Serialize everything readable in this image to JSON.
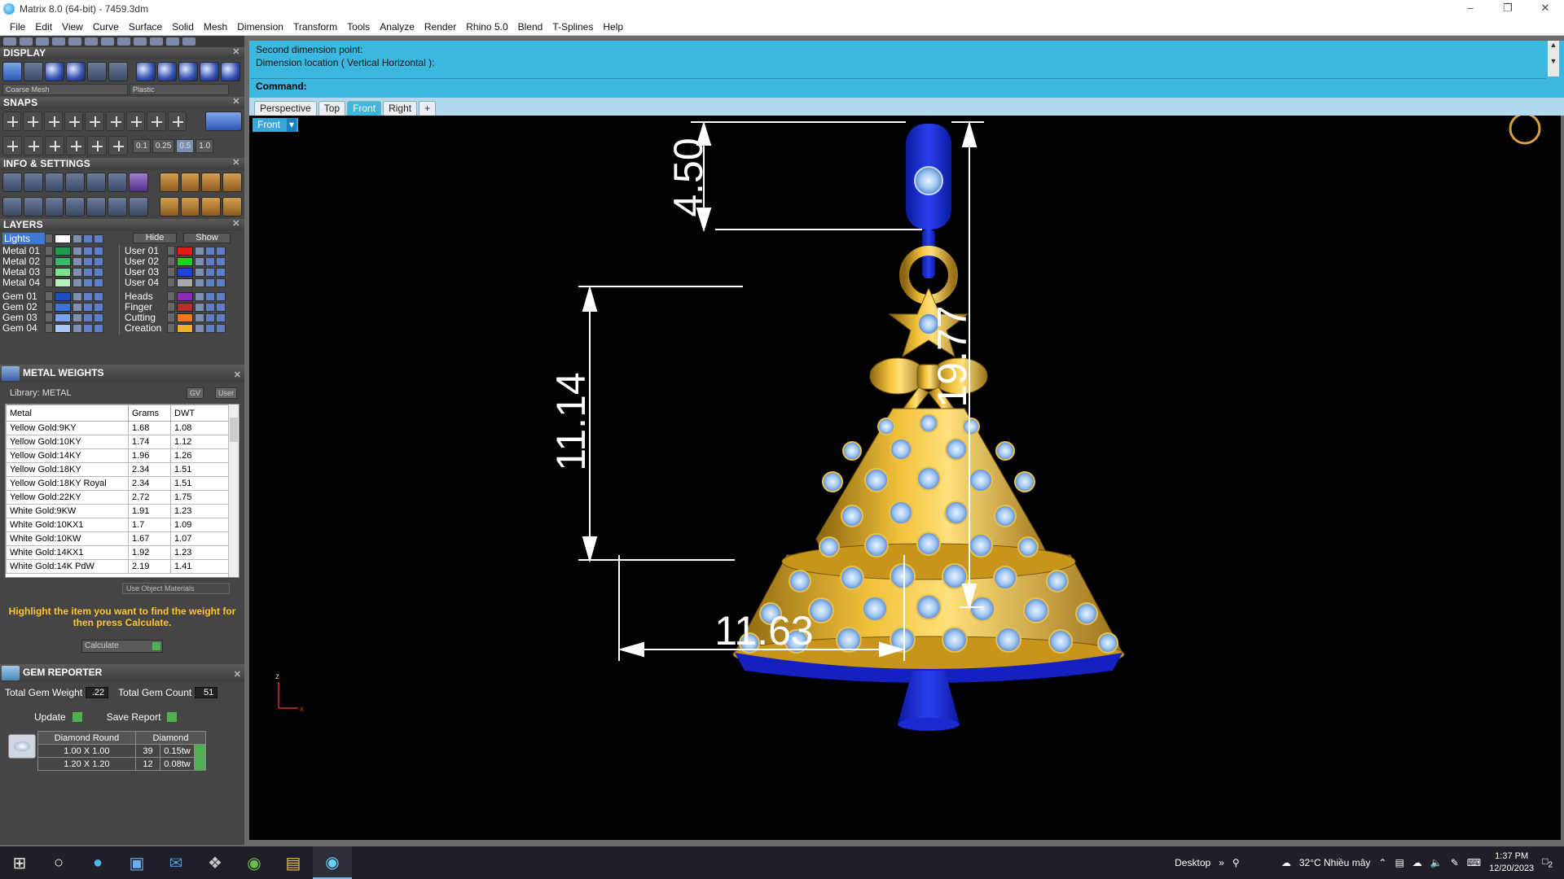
{
  "window": {
    "title": "Matrix 8.0 (64-bit) - 7459.3dm"
  },
  "menu": [
    "File",
    "Edit",
    "View",
    "Curve",
    "Surface",
    "Solid",
    "Mesh",
    "Dimension",
    "Transform",
    "Tools",
    "Analyze",
    "Render",
    "Rhino 5.0",
    "Blend",
    "T-Splines",
    "Help"
  ],
  "display": {
    "title": "DISPLAY",
    "mesh_combo": "Coarse Mesh",
    "material_combo": "Plastic"
  },
  "snaps": {
    "title": "SNAPS",
    "values": [
      "0.1",
      "0.25",
      "0.5",
      "1.0"
    ],
    "selected": "0.5"
  },
  "info": {
    "title": "INFO & SETTINGS"
  },
  "layers": {
    "title": "LAYERS",
    "lights_label": "Lights",
    "hide_label": "Hide",
    "show_label": "Show",
    "left": [
      {
        "name": "Metal 01",
        "color": "#1f9a50"
      },
      {
        "name": "Metal 02",
        "color": "#39b86a"
      },
      {
        "name": "Metal 03",
        "color": "#7ce08f"
      },
      {
        "name": "Metal 04",
        "color": "#b9f3b9"
      },
      {
        "name": "Gem 01",
        "color": "#1f4fc0"
      },
      {
        "name": "Gem 02",
        "color": "#3d73d9"
      },
      {
        "name": "Gem 03",
        "color": "#7aa2ee"
      },
      {
        "name": "Gem 04",
        "color": "#a9c6f6"
      }
    ],
    "right": [
      {
        "name": "User 01",
        "color": "#e21a1a"
      },
      {
        "name": "User 02",
        "color": "#20d020"
      },
      {
        "name": "User 03",
        "color": "#2040e0"
      },
      {
        "name": "User 04",
        "color": "#a8a8a8"
      },
      {
        "name": "Heads",
        "color": "#8a2ab8"
      },
      {
        "name": "Finger",
        "color": "#b03030"
      },
      {
        "name": "Cutting",
        "color": "#f07a10"
      },
      {
        "name": "Creation",
        "color": "#f0b020"
      }
    ]
  },
  "metal_weights": {
    "title": "METAL WEIGHTS",
    "library": "Library: METAL",
    "gv": "GV",
    "user": "User",
    "columns": [
      "Metal",
      "Grams",
      "DWT"
    ],
    "rows": [
      [
        "Yellow Gold:9KY",
        "1.68",
        "1.08"
      ],
      [
        "Yellow Gold:10KY",
        "1.74",
        "1.12"
      ],
      [
        "Yellow Gold:14KY",
        "1.96",
        "1.26"
      ],
      [
        "Yellow Gold:18KY",
        "2.34",
        "1.51"
      ],
      [
        "Yellow Gold:18KY Royal",
        "2.34",
        "1.51"
      ],
      [
        "Yellow Gold:22KY",
        "2.72",
        "1.75"
      ],
      [
        "White Gold:9KW",
        "1.91",
        "1.23"
      ],
      [
        "White Gold:10KX1",
        "1.7",
        "1.09"
      ],
      [
        "White Gold:10KW",
        "1.67",
        "1.07"
      ],
      [
        "White Gold:14KX1",
        "1.92",
        "1.23"
      ],
      [
        "White Gold:14K PdW",
        "2.19",
        "1.41"
      ]
    ],
    "use_object_materials": "Use Object Materials",
    "hint": "Highlight the item you want to find the weight for then press Calculate.",
    "calculate": "Calculate"
  },
  "gem_reporter": {
    "title": "GEM REPORTER",
    "total_weight_label": "Total Gem Weight",
    "total_weight": ".22",
    "total_count_label": "Total Gem Count",
    "total_count": "51",
    "update": "Update",
    "save_report": "Save Report",
    "columns": [
      "Diamond Round",
      "Diamond"
    ],
    "rows": [
      [
        "1.00 X 1.00",
        "39",
        "0.15tw"
      ],
      [
        "1.20 X 1.20",
        "12",
        "0.08tw"
      ]
    ]
  },
  "command": {
    "history": [
      "Second dimension point:",
      "Dimension location ( Vertical  Horizontal ):"
    ],
    "prompt": "Command:"
  },
  "viewport": {
    "tabs": [
      "Perspective",
      "Top",
      "Front",
      "Right",
      "+"
    ],
    "active_tab": "Front",
    "label": "Front",
    "dimensions": {
      "top_height": "4.50",
      "body_height": "11.14",
      "total_height": "19.77",
      "width": "11.63"
    },
    "axis": {
      "z": "z",
      "x": "x"
    }
  },
  "taskbar": {
    "desktop": "Desktop",
    "weather": "32°C  Nhiều mây",
    "time": "1:37 PM",
    "date": "12/20/2023",
    "notifications": "2"
  }
}
